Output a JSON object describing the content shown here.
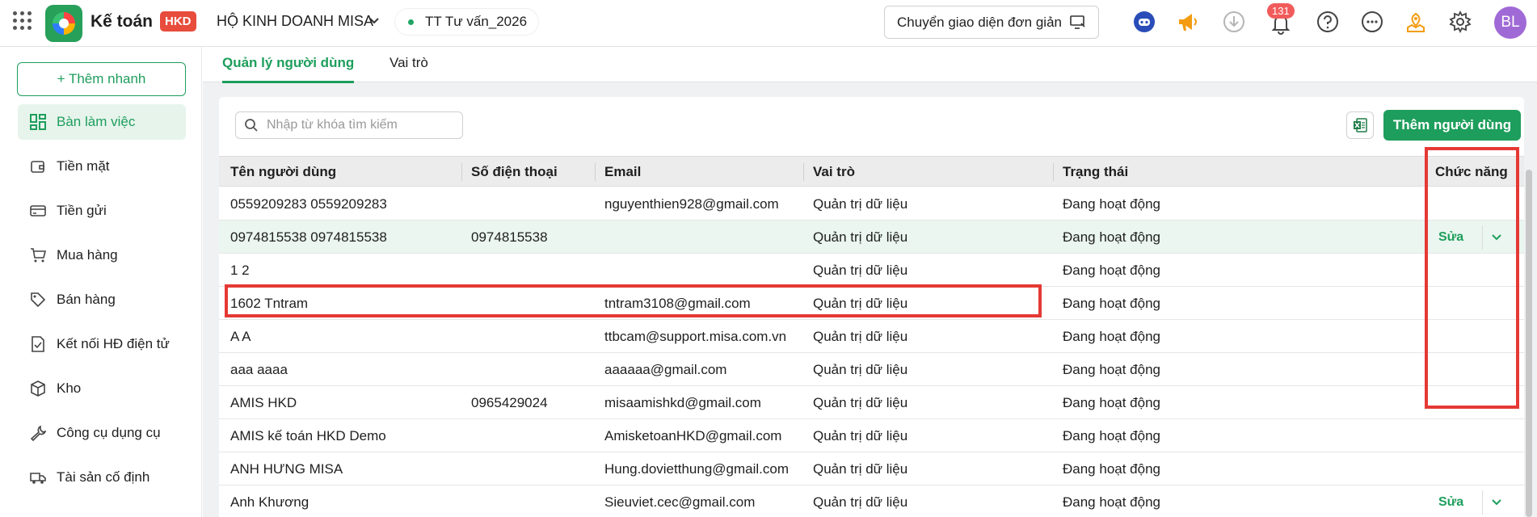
{
  "header": {
    "app_name": "Kế toán",
    "badge": "HKD",
    "company": "HỘ KINH DOANH MISA",
    "environment": "TT Tư vấn_2026",
    "switch_ui": "Chuyển giao diện đơn giản",
    "notifications": "131",
    "avatar": "BL",
    "icons": [
      "apps-grid-icon",
      "bot-icon",
      "megaphone-icon",
      "download-icon",
      "bell-icon",
      "help-icon",
      "more-icon",
      "map-pin-icon",
      "gear-icon"
    ]
  },
  "sidebar": {
    "quick_add": "+ Thêm nhanh",
    "items": [
      {
        "label": "Bàn làm việc",
        "icon": "dashboard-icon",
        "active": true
      },
      {
        "label": "Tiền mặt",
        "icon": "wallet-icon"
      },
      {
        "label": "Tiền gửi",
        "icon": "card-icon"
      },
      {
        "label": "Mua hàng",
        "icon": "cart-icon"
      },
      {
        "label": "Bán hàng",
        "icon": "tag-icon"
      },
      {
        "label": "Kết nối HĐ điện tử",
        "icon": "invoice-icon"
      },
      {
        "label": "Kho",
        "icon": "box-icon"
      },
      {
        "label": "Công cụ dụng cụ",
        "icon": "wrench-icon"
      },
      {
        "label": "Tài sản cố định",
        "icon": "truck-icon"
      }
    ]
  },
  "tabs": [
    {
      "label": "Quản lý người dùng",
      "active": true
    },
    {
      "label": "Vai trò",
      "active": false
    }
  ],
  "toolbar": {
    "search_placeholder": "Nhập từ khóa tìm kiếm",
    "add_user": "Thêm người dùng"
  },
  "table": {
    "columns": [
      "Tên người dùng",
      "Số điện thoại",
      "Email",
      "Vai trò",
      "Trạng thái",
      "Chức năng"
    ],
    "edit_label": "Sửa",
    "rows": [
      {
        "name": "0559209283 0559209283",
        "phone": "",
        "email": "nguyenthien928@gmail.com",
        "role": "Quản trị dữ liệu",
        "status": "Đang hoạt động"
      },
      {
        "name": "0974815538 0974815538",
        "phone": "0974815538",
        "email": "",
        "role": "Quản trị dữ liệu",
        "status": "Đang hoạt động"
      },
      {
        "name": "1 2",
        "phone": "",
        "email": "",
        "role": "Quản trị dữ liệu",
        "status": "Đang hoạt động"
      },
      {
        "name": "1602 Tntram",
        "phone": "",
        "email": "tntram3108@gmail.com",
        "role": "Quản trị dữ liệu",
        "status": "Đang hoạt động"
      },
      {
        "name": "A A",
        "phone": "",
        "email": "ttbcam@support.misa.com.vn",
        "role": "Quản trị dữ liệu",
        "status": "Đang hoạt động"
      },
      {
        "name": "aaa aaaa",
        "phone": "",
        "email": "aaaaaa@gmail.com",
        "role": "Quản trị dữ liệu",
        "status": "Đang hoạt động"
      },
      {
        "name": "AMIS HKD",
        "phone": "0965429024",
        "email": "misaamishkd@gmail.com",
        "role": "Quản trị dữ liệu",
        "status": "Đang hoạt động"
      },
      {
        "name": "AMIS kế toán HKD Demo",
        "phone": "",
        "email": "AmisketoanHKD@gmail.com",
        "role": "Quản trị dữ liệu",
        "status": "Đang hoạt động"
      },
      {
        "name": "ANH HƯNG MISA",
        "phone": "",
        "email": "Hung.dovietthung@gmail.com",
        "role": "Quản trị dữ liệu",
        "status": "Đang hoạt động"
      },
      {
        "name": "Anh Khương",
        "phone": "",
        "email": "Sieuviet.cec@gmail.com",
        "role": "Quản trị dữ liệu",
        "status": "Đang hoạt động"
      }
    ]
  }
}
